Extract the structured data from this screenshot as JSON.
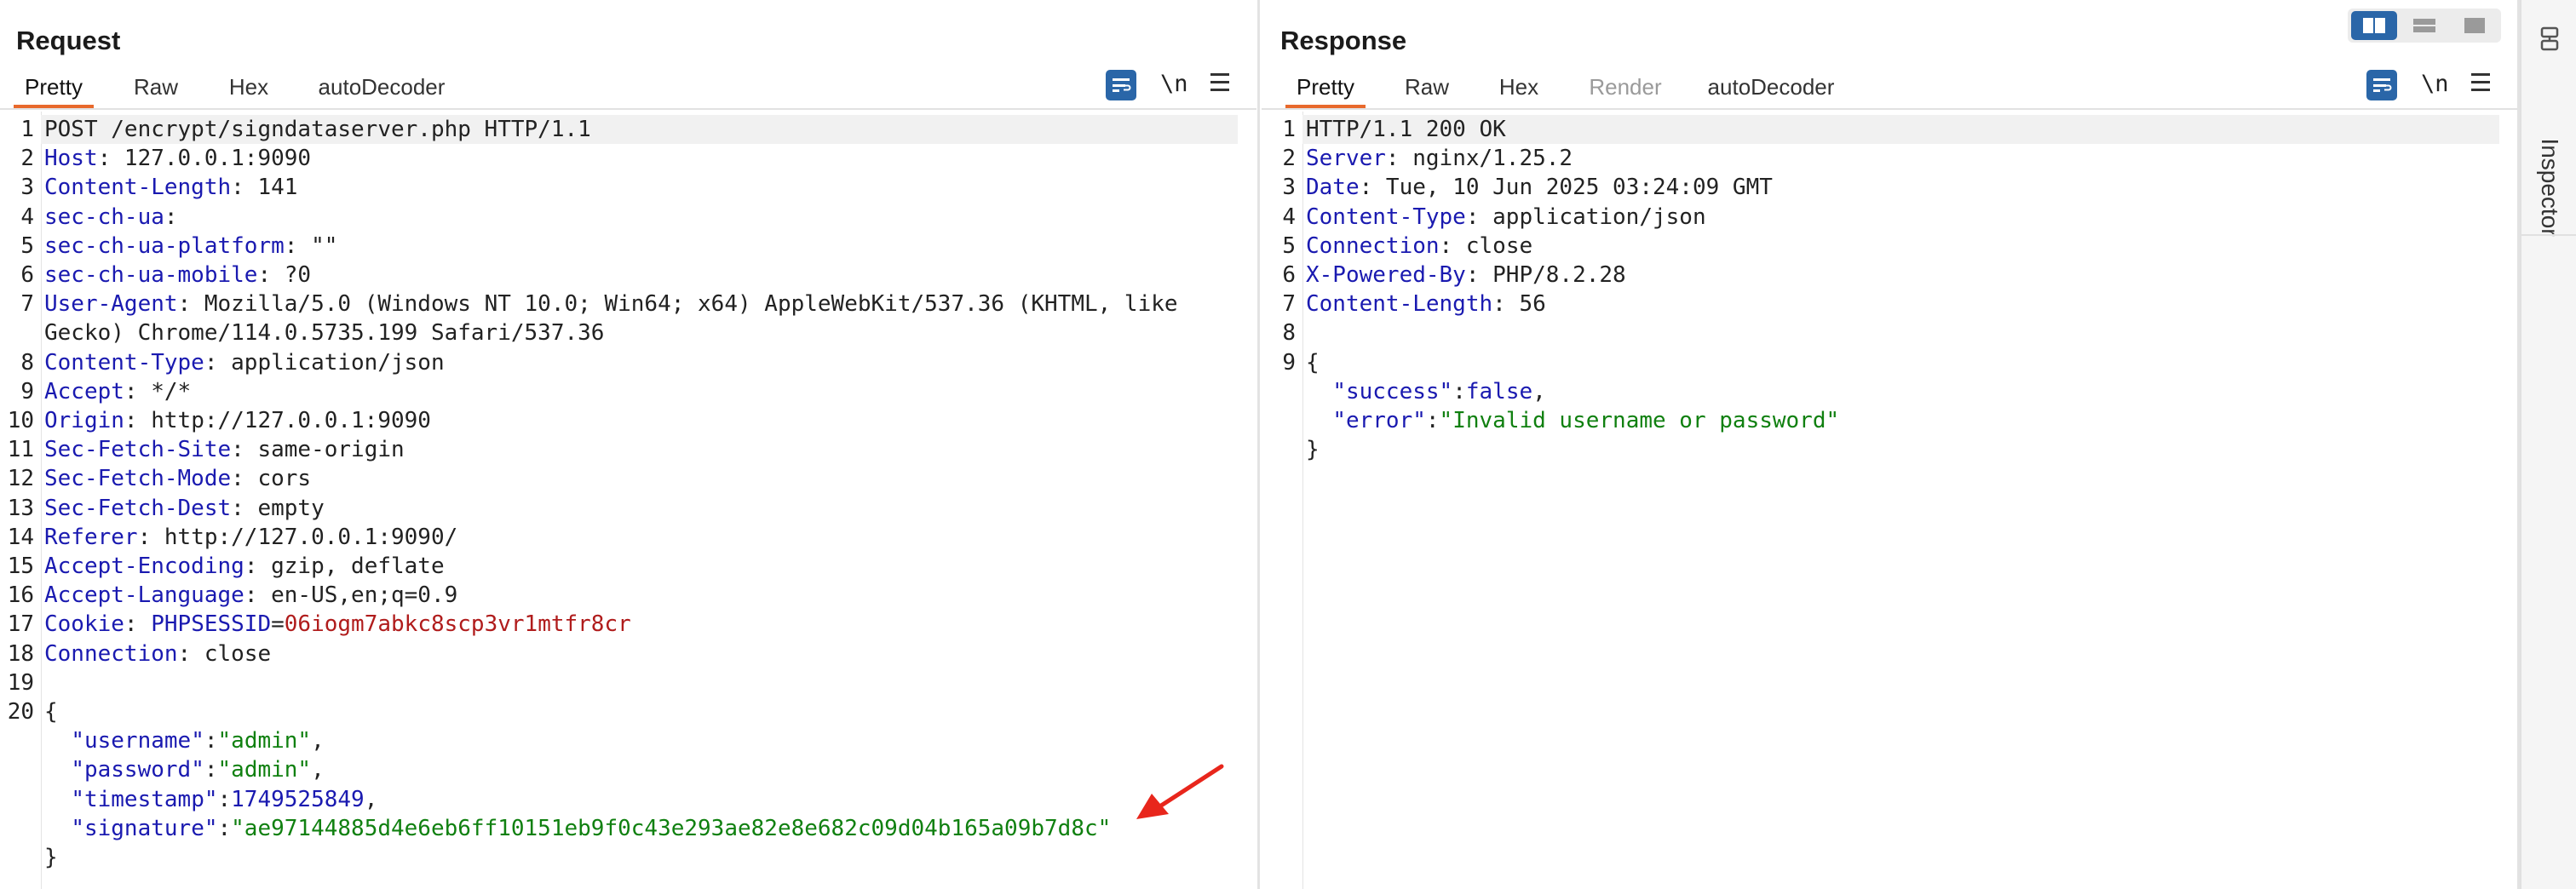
{
  "request": {
    "title": "Request",
    "tabs": [
      "Pretty",
      "Raw",
      "Hex",
      "autoDecoder"
    ],
    "active_tab": "Pretty",
    "newline_label": "\\n",
    "lines": [
      {
        "n": "1",
        "segs": [
          {
            "c": "t",
            "v": "POST /encrypt/signdataserver.php HTTP/1.1"
          }
        ]
      },
      {
        "n": "2",
        "segs": [
          {
            "c": "k",
            "v": "Host"
          },
          {
            "c": "t",
            "v": ": 127.0.0.1:9090"
          }
        ]
      },
      {
        "n": "3",
        "segs": [
          {
            "c": "k",
            "v": "Content-Length"
          },
          {
            "c": "t",
            "v": ": 141"
          }
        ]
      },
      {
        "n": "4",
        "segs": [
          {
            "c": "k",
            "v": "sec-ch-ua"
          },
          {
            "c": "t",
            "v": ":"
          }
        ]
      },
      {
        "n": "5",
        "segs": [
          {
            "c": "k",
            "v": "sec-ch-ua-platform"
          },
          {
            "c": "t",
            "v": ": \"\""
          }
        ]
      },
      {
        "n": "6",
        "segs": [
          {
            "c": "k",
            "v": "sec-ch-ua-mobile"
          },
          {
            "c": "t",
            "v": ": ?0"
          }
        ]
      },
      {
        "n": "7",
        "segs": [
          {
            "c": "k",
            "v": "User-Agent"
          },
          {
            "c": "t",
            "v": ": Mozilla/5.0 (Windows NT 10.0; Win64; x64) AppleWebKit/537.36 (KHTML, like"
          }
        ]
      },
      {
        "n": "",
        "segs": [
          {
            "c": "t",
            "v": "Gecko) Chrome/114.0.5735.199 Safari/537.36"
          }
        ]
      },
      {
        "n": "8",
        "segs": [
          {
            "c": "k",
            "v": "Content-Type"
          },
          {
            "c": "t",
            "v": ": application/json"
          }
        ]
      },
      {
        "n": "9",
        "segs": [
          {
            "c": "k",
            "v": "Accept"
          },
          {
            "c": "t",
            "v": ": */*"
          }
        ]
      },
      {
        "n": "10",
        "segs": [
          {
            "c": "k",
            "v": "Origin"
          },
          {
            "c": "t",
            "v": ": http://127.0.0.1:9090"
          }
        ]
      },
      {
        "n": "11",
        "segs": [
          {
            "c": "k",
            "v": "Sec-Fetch-Site"
          },
          {
            "c": "t",
            "v": ": same-origin"
          }
        ]
      },
      {
        "n": "12",
        "segs": [
          {
            "c": "k",
            "v": "Sec-Fetch-Mode"
          },
          {
            "c": "t",
            "v": ": cors"
          }
        ]
      },
      {
        "n": "13",
        "segs": [
          {
            "c": "k",
            "v": "Sec-Fetch-Dest"
          },
          {
            "c": "t",
            "v": ": empty"
          }
        ]
      },
      {
        "n": "14",
        "segs": [
          {
            "c": "k",
            "v": "Referer"
          },
          {
            "c": "t",
            "v": ": http://127.0.0.1:9090/"
          }
        ]
      },
      {
        "n": "15",
        "segs": [
          {
            "c": "k",
            "v": "Accept-Encoding"
          },
          {
            "c": "t",
            "v": ": gzip, deflate"
          }
        ]
      },
      {
        "n": "16",
        "segs": [
          {
            "c": "k",
            "v": "Accept-Language"
          },
          {
            "c": "t",
            "v": ": en-US,en;q=0.9"
          }
        ]
      },
      {
        "n": "17",
        "segs": [
          {
            "c": "k",
            "v": "Cookie"
          },
          {
            "c": "t",
            "v": ": "
          },
          {
            "c": "ck",
            "v": "PHPSESSID"
          },
          {
            "c": "t",
            "v": "="
          },
          {
            "c": "cv",
            "v": "06iogm7abkc8scp3vr1mtfr8cr"
          }
        ]
      },
      {
        "n": "18",
        "segs": [
          {
            "c": "k",
            "v": "Connection"
          },
          {
            "c": "t",
            "v": ": close"
          }
        ]
      },
      {
        "n": "19",
        "segs": []
      },
      {
        "n": "20",
        "segs": [
          {
            "c": "t",
            "v": "{"
          }
        ]
      },
      {
        "n": "",
        "segs": [
          {
            "c": "t",
            "v": "  "
          },
          {
            "c": "k",
            "v": "\"username\""
          },
          {
            "c": "t",
            "v": ":"
          },
          {
            "c": "s",
            "v": "\"admin\""
          },
          {
            "c": "t",
            "v": ","
          }
        ]
      },
      {
        "n": "",
        "segs": [
          {
            "c": "t",
            "v": "  "
          },
          {
            "c": "k",
            "v": "\"password\""
          },
          {
            "c": "t",
            "v": ":"
          },
          {
            "c": "s",
            "v": "\"admin\""
          },
          {
            "c": "t",
            "v": ","
          }
        ]
      },
      {
        "n": "",
        "segs": [
          {
            "c": "t",
            "v": "  "
          },
          {
            "c": "k",
            "v": "\"timestamp\""
          },
          {
            "c": "t",
            "v": ":"
          },
          {
            "c": "n",
            "v": "1749525849"
          },
          {
            "c": "t",
            "v": ","
          }
        ]
      },
      {
        "n": "",
        "segs": [
          {
            "c": "t",
            "v": "  "
          },
          {
            "c": "k",
            "v": "\"signature\""
          },
          {
            "c": "t",
            "v": ":"
          },
          {
            "c": "s",
            "v": "\"ae97144885d4e6eb6ff10151eb9f0c43e293ae82e8e682c09d04b165a09b7d8c\""
          }
        ]
      },
      {
        "n": "",
        "segs": [
          {
            "c": "t",
            "v": "}"
          }
        ]
      }
    ]
  },
  "response": {
    "title": "Response",
    "tabs": [
      "Pretty",
      "Raw",
      "Hex",
      "Render",
      "autoDecoder"
    ],
    "active_tab": "Pretty",
    "disabled_tab": "Render",
    "newline_label": "\\n",
    "lines": [
      {
        "n": "1",
        "segs": [
          {
            "c": "t",
            "v": "HTTP/1.1 200 OK"
          }
        ]
      },
      {
        "n": "2",
        "segs": [
          {
            "c": "k",
            "v": "Server"
          },
          {
            "c": "t",
            "v": ": nginx/1.25.2"
          }
        ]
      },
      {
        "n": "3",
        "segs": [
          {
            "c": "k",
            "v": "Date"
          },
          {
            "c": "t",
            "v": ": Tue, 10 Jun 2025 03:24:09 GMT"
          }
        ]
      },
      {
        "n": "4",
        "segs": [
          {
            "c": "k",
            "v": "Content-Type"
          },
          {
            "c": "t",
            "v": ": application/json"
          }
        ]
      },
      {
        "n": "5",
        "segs": [
          {
            "c": "k",
            "v": "Connection"
          },
          {
            "c": "t",
            "v": ": close"
          }
        ]
      },
      {
        "n": "6",
        "segs": [
          {
            "c": "k",
            "v": "X-Powered-By"
          },
          {
            "c": "t",
            "v": ": PHP/8.2.28"
          }
        ]
      },
      {
        "n": "7",
        "segs": [
          {
            "c": "k",
            "v": "Content-Length"
          },
          {
            "c": "t",
            "v": ": 56"
          }
        ]
      },
      {
        "n": "8",
        "segs": []
      },
      {
        "n": "9",
        "segs": [
          {
            "c": "t",
            "v": "{"
          }
        ]
      },
      {
        "n": "",
        "segs": [
          {
            "c": "t",
            "v": "  "
          },
          {
            "c": "k",
            "v": "\"success\""
          },
          {
            "c": "t",
            "v": ":"
          },
          {
            "c": "n",
            "v": "false"
          },
          {
            "c": "t",
            "v": ","
          }
        ]
      },
      {
        "n": "",
        "segs": [
          {
            "c": "t",
            "v": "  "
          },
          {
            "c": "k",
            "v": "\"error\""
          },
          {
            "c": "t",
            "v": ":"
          },
          {
            "c": "s",
            "v": "\"Invalid username or password\""
          }
        ]
      },
      {
        "n": "",
        "segs": [
          {
            "c": "t",
            "v": "}"
          }
        ]
      }
    ]
  },
  "inspector": {
    "label": "Inspector"
  },
  "layout_toggle": {
    "active": "side-by-side"
  },
  "colors": {
    "accent": "#e8692c",
    "key": "#1a1ab0",
    "string": "#108010",
    "cookie_value": "#b01c1c",
    "tool_button": "#2a66a8",
    "annotation_arrow": "#e8261c"
  },
  "icons": [
    "word-wrap-icon",
    "menu-icon",
    "layout-side-by-side-icon",
    "layout-stacked-icon",
    "layout-single-icon",
    "inspector-icon",
    "red-arrow-annotation"
  ]
}
